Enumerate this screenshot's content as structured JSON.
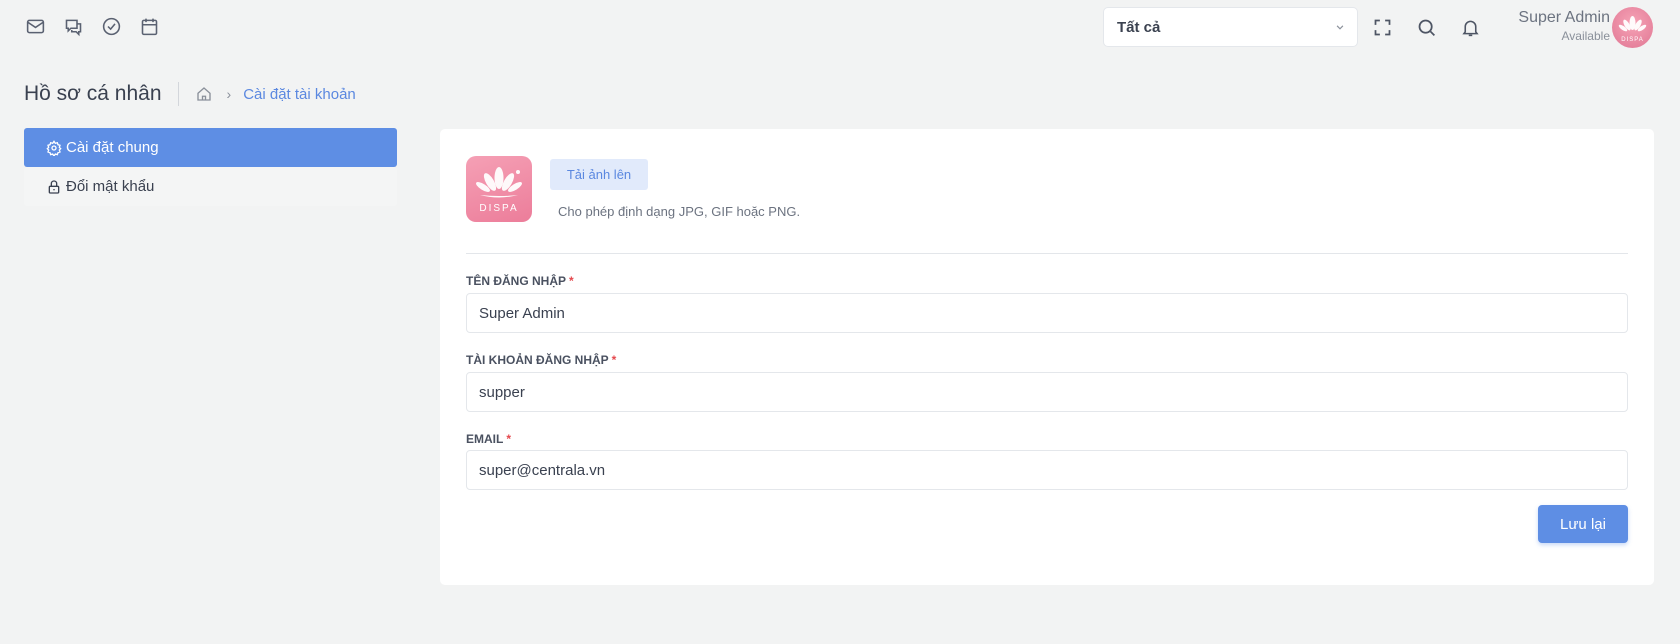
{
  "topbar": {
    "left_icons": [
      "mail-icon",
      "chat-icon",
      "check-circle-icon",
      "calendar-icon"
    ],
    "filter_select": {
      "value": "Tất cả"
    },
    "right_tools": [
      "fullscreen-icon",
      "search-icon",
      "bell-icon"
    ],
    "user": {
      "name": "Super Admin",
      "status": "Available",
      "avatar_text": "DISPA"
    }
  },
  "page": {
    "title": "Hồ sơ cá nhân",
    "breadcrumb": {
      "current": "Cài đặt tài khoản"
    }
  },
  "sidebar": {
    "items": [
      {
        "label": "Cài đặt chung",
        "icon": "gear-icon",
        "active": true
      },
      {
        "label": "Đổi mật khẩu",
        "icon": "lock-icon",
        "active": false
      }
    ]
  },
  "profile": {
    "logo_text": "DISPA",
    "upload_label": "Tải ảnh lên",
    "upload_hint": "Cho phép định dạng JPG, GIF hoặc PNG.",
    "fields": [
      {
        "label": "TÊN ĐĂNG NHẬP",
        "required": "*",
        "value": "Super Admin"
      },
      {
        "label": "TÀI KHOẢN ĐĂNG NHẬP",
        "required": "*",
        "value": "supper"
      },
      {
        "label": "EMAIL",
        "required": "*",
        "value": "super@centrala.vn"
      }
    ],
    "save_label": "Lưu lại"
  },
  "colors": {
    "accent": "#5e8ee4",
    "background": "#f2f3f3",
    "brand_pink": "#ec7d9a",
    "required": "#e5484d"
  }
}
